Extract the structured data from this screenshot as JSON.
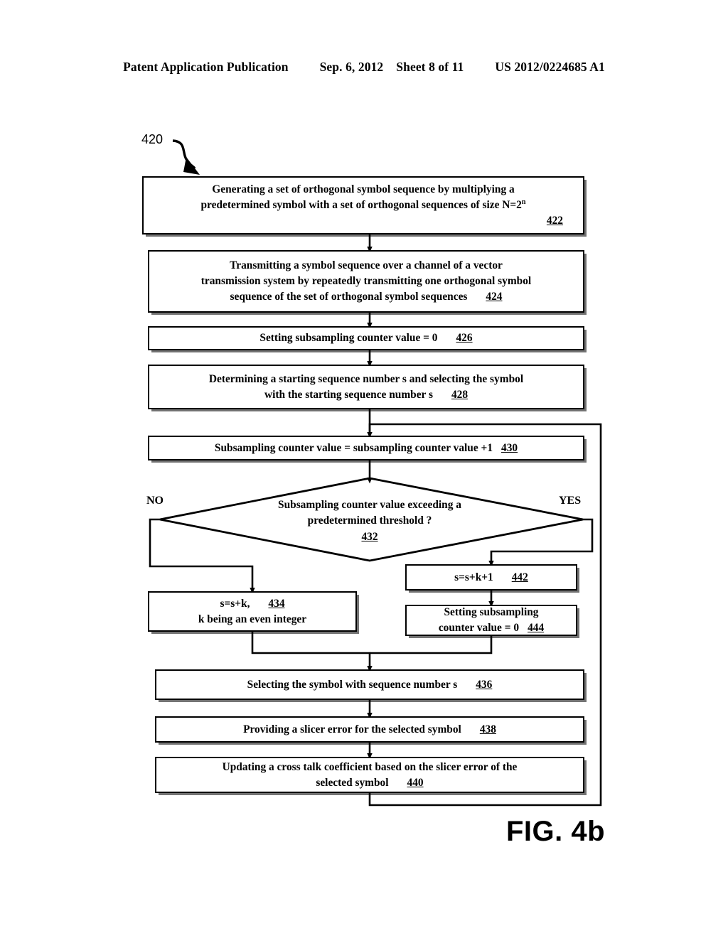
{
  "header": {
    "publication": "Patent Application Publication",
    "date": "Sep. 6, 2012",
    "sheet": "Sheet 8 of 11",
    "patent_number": "US 2012/0224685 A1"
  },
  "figure": {
    "caption": "FIG. 4b",
    "callout": "420"
  },
  "flowchart": {
    "nodes": [
      {
        "id": "422",
        "type": "process",
        "line1": "Generating a set of orthogonal symbol sequence by multiplying a",
        "line2_a": "predetermined symbol with a set of  orthogonal sequences of size N=2",
        "line2_sup": "n",
        "ref": "422"
      },
      {
        "id": "424",
        "type": "process",
        "line1": "Transmitting a symbol sequence over a channel of a vector",
        "line2": "transmission system by repeatedly transmitting one orthogonal symbol",
        "line3": "sequence of the set of orthogonal symbol sequences",
        "ref": "424"
      },
      {
        "id": "426",
        "type": "process",
        "line1": "Setting subsampling counter value = 0",
        "ref": "426"
      },
      {
        "id": "428",
        "type": "process",
        "line1": "Determining a starting sequence number s and selecting  the  symbol",
        "line2": "with the starting sequence number s",
        "ref": "428"
      },
      {
        "id": "430",
        "type": "process",
        "line1": "Subsampling counter value = subsampling counter value +1",
        "ref": "430"
      },
      {
        "id": "432",
        "type": "decision",
        "line1": "Subsampling counter value exceeding a",
        "line2": "predetermined threshold ?",
        "ref": "432",
        "label_no": "NO",
        "label_yes": "YES"
      },
      {
        "id": "434",
        "type": "process",
        "line1": "s=s+k,",
        "line2": "k being an even integer",
        "ref": "434"
      },
      {
        "id": "442",
        "type": "process",
        "line1": "s=s+k+1",
        "ref": "442"
      },
      {
        "id": "444",
        "type": "process",
        "line1": "Setting subsampling",
        "line2": "counter value = 0",
        "ref": "444"
      },
      {
        "id": "436",
        "type": "process",
        "line1": "Selecting the symbol with sequence number s",
        "ref": "436"
      },
      {
        "id": "438",
        "type": "process",
        "line1": "Providing a slicer error for the selected symbol",
        "ref": "438"
      },
      {
        "id": "440",
        "type": "process",
        "line1": "Updating a cross talk coefficient based on the slicer error of the",
        "line2": "selected symbol",
        "ref": "440"
      }
    ]
  }
}
